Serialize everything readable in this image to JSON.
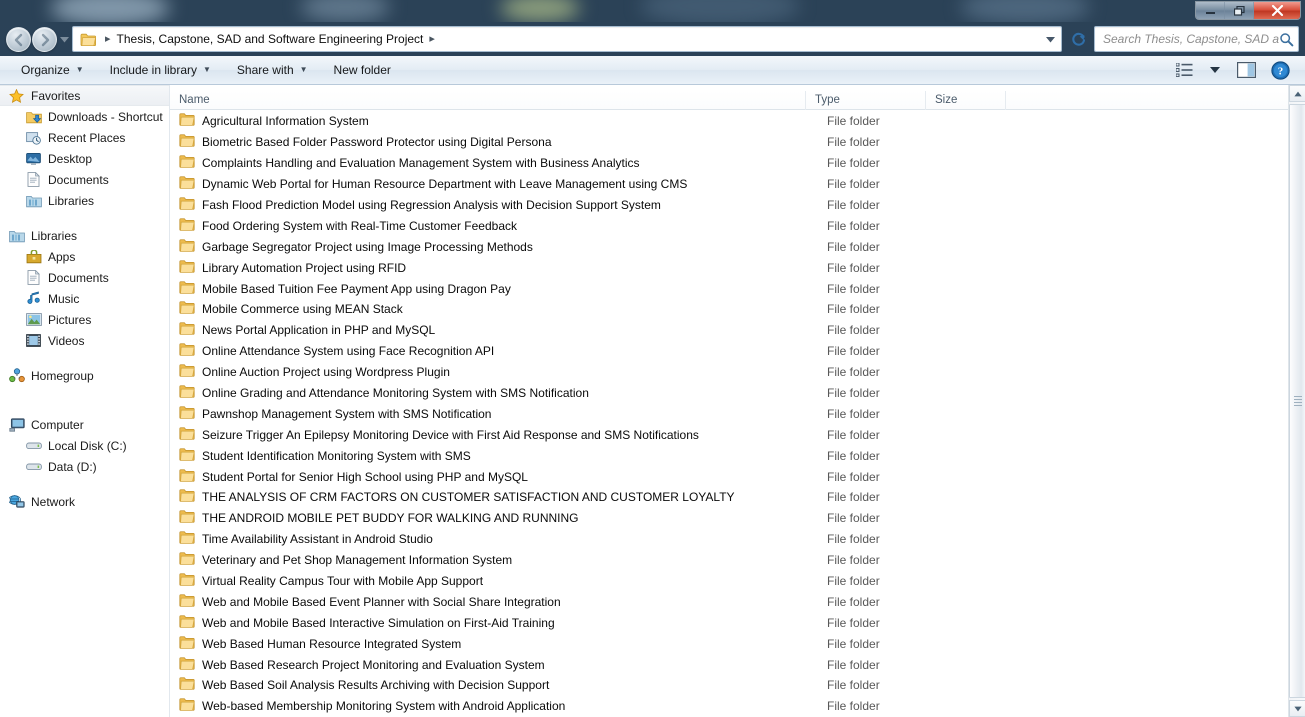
{
  "window": {
    "controls": {
      "minimize": "minimize-button",
      "restore": "restore-button",
      "close": "close-button"
    }
  },
  "address_bar": {
    "path_text": "Thesis, Capstone, SAD and Software Engineering Project",
    "leading_sep": "▸",
    "trailing_sep": "▸",
    "back_title": "Back",
    "forward_title": "Forward",
    "recent_dropdown": "▼",
    "history_dropdown": "▼",
    "refresh": "refresh-button"
  },
  "search": {
    "placeholder": "Search Thesis, Capstone, SAD a..."
  },
  "command_bar": {
    "items": [
      {
        "label": "Organize",
        "caret": "▼"
      },
      {
        "label": "Include in library",
        "caret": "▼"
      },
      {
        "label": "Share with",
        "caret": "▼"
      },
      {
        "label": "New folder",
        "caret": ""
      }
    ],
    "view_caret": "▼",
    "view_button": "change-view-button",
    "preview_button": "preview-pane-button",
    "help_button": "help-button",
    "help_glyph": "?"
  },
  "navigation_pane": {
    "groups": [
      {
        "header": {
          "label": "Favorites",
          "icon": "star-icon",
          "selected": true
        },
        "items": [
          {
            "label": "Downloads - Shortcut",
            "icon": "downloads-folder-icon"
          },
          {
            "label": "Recent Places",
            "icon": "recent-places-icon"
          },
          {
            "label": "Desktop",
            "icon": "desktop-icon"
          },
          {
            "label": "Documents",
            "icon": "document-icon"
          },
          {
            "label": "Libraries",
            "icon": "library-folder-icon"
          }
        ]
      },
      {
        "header": {
          "label": "Libraries",
          "icon": "library-folder-icon",
          "selected": false
        },
        "items": [
          {
            "label": "Apps",
            "icon": "apps-library-icon"
          },
          {
            "label": "Documents",
            "icon": "document-icon"
          },
          {
            "label": "Music",
            "icon": "music-note-icon"
          },
          {
            "label": "Pictures",
            "icon": "pictures-icon"
          },
          {
            "label": "Videos",
            "icon": "video-film-icon"
          }
        ]
      },
      {
        "header": {
          "label": "Homegroup",
          "icon": "homegroup-icon",
          "selected": false
        },
        "items": []
      },
      {
        "header": {
          "label": "Computer",
          "icon": "computer-icon",
          "selected": false
        },
        "items": [
          {
            "label": "Local Disk (C:)",
            "icon": "hard-drive-icon"
          },
          {
            "label": "Data (D:)",
            "icon": "hard-drive-icon"
          }
        ]
      },
      {
        "header": {
          "label": "Network",
          "icon": "network-icon",
          "selected": false
        },
        "items": []
      }
    ]
  },
  "file_list": {
    "sort_indicator": "ascending",
    "columns": [
      {
        "key": "name",
        "label": "Name"
      },
      {
        "key": "type",
        "label": "Type"
      },
      {
        "key": "size",
        "label": "Size"
      }
    ],
    "rows": [
      {
        "name": "Agricultural Information System",
        "type": "File folder",
        "size": ""
      },
      {
        "name": "Biometric Based Folder Password Protector using Digital Persona",
        "type": "File folder",
        "size": ""
      },
      {
        "name": "Complaints Handling and Evaluation Management System with Business Analytics",
        "type": "File folder",
        "size": ""
      },
      {
        "name": "Dynamic Web Portal for Human Resource Department with Leave Management using CMS",
        "type": "File folder",
        "size": ""
      },
      {
        "name": "Fash Flood Prediction Model using Regression Analysis with Decision Support System",
        "type": "File folder",
        "size": ""
      },
      {
        "name": "Food Ordering System with Real-Time Customer Feedback",
        "type": "File folder",
        "size": ""
      },
      {
        "name": "Garbage Segregator Project using Image Processing Methods",
        "type": "File folder",
        "size": ""
      },
      {
        "name": "Library Automation Project using RFID",
        "type": "File folder",
        "size": ""
      },
      {
        "name": "Mobile Based Tuition Fee Payment App using Dragon Pay",
        "type": "File folder",
        "size": ""
      },
      {
        "name": "Mobile Commerce using MEAN Stack",
        "type": "File folder",
        "size": ""
      },
      {
        "name": "News Portal Application in PHP and MySQL",
        "type": "File folder",
        "size": ""
      },
      {
        "name": "Online Attendance System using Face Recognition API",
        "type": "File folder",
        "size": ""
      },
      {
        "name": "Online Auction Project using Wordpress Plugin",
        "type": "File folder",
        "size": ""
      },
      {
        "name": "Online Grading and Attendance Monitoring System with SMS Notification",
        "type": "File folder",
        "size": ""
      },
      {
        "name": "Pawnshop Management System with SMS Notification",
        "type": "File folder",
        "size": ""
      },
      {
        "name": "Seizure Trigger An Epilepsy Monitoring Device with First Aid Response and SMS Notifications",
        "type": "File folder",
        "size": ""
      },
      {
        "name": "Student Identification Monitoring System with SMS",
        "type": "File folder",
        "size": ""
      },
      {
        "name": "Student Portal for Senior High School using PHP and MySQL",
        "type": "File folder",
        "size": ""
      },
      {
        "name": "THE ANALYSIS OF CRM FACTORS ON CUSTOMER SATISFACTION AND CUSTOMER LOYALTY",
        "type": "File folder",
        "size": ""
      },
      {
        "name": "THE ANDROID MOBILE PET BUDDY FOR WALKING AND RUNNING",
        "type": "File folder",
        "size": ""
      },
      {
        "name": "Time Availability Assistant in Android Studio",
        "type": "File folder",
        "size": ""
      },
      {
        "name": "Veterinary and Pet Shop Management Information System",
        "type": "File folder",
        "size": ""
      },
      {
        "name": "Virtual Reality Campus Tour with Mobile App Support",
        "type": "File folder",
        "size": ""
      },
      {
        "name": "Web and Mobile Based Event Planner with Social Share Integration",
        "type": "File folder",
        "size": ""
      },
      {
        "name": "Web and Mobile Based Interactive Simulation on First-Aid Training",
        "type": "File folder",
        "size": ""
      },
      {
        "name": "Web Based Human Resource Integrated System",
        "type": "File folder",
        "size": ""
      },
      {
        "name": "Web Based Research Project Monitoring and Evaluation System",
        "type": "File folder",
        "size": ""
      },
      {
        "name": "Web Based Soil Analysis Results Archiving with Decision Support",
        "type": "File folder",
        "size": ""
      },
      {
        "name": "Web-based Membership Monitoring System with Android Application",
        "type": "File folder",
        "size": ""
      }
    ]
  },
  "scrollbar": {
    "up_arrow": "▲",
    "down_arrow": "▼"
  },
  "colors": {
    "accent": "#2b4257",
    "close_red": "#bf3722",
    "folder_gold": "#f5c95a",
    "link_text": "#1a1a1a"
  }
}
